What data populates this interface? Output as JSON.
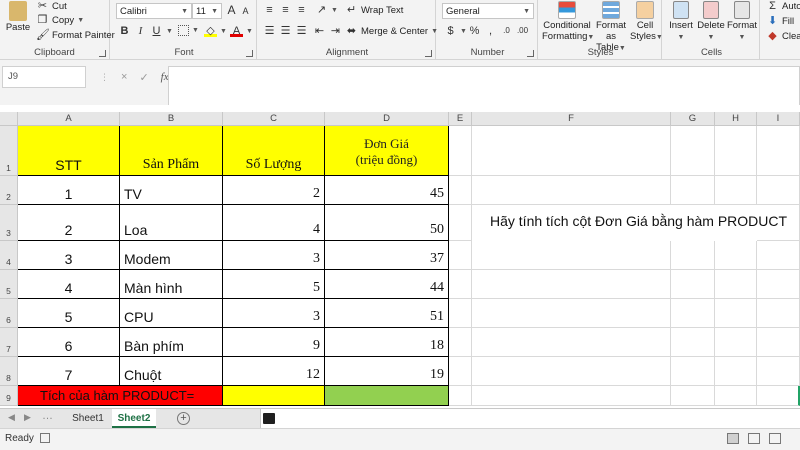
{
  "ribbon": {
    "clipboard": {
      "paste": "Paste",
      "cut": "Cut",
      "copy": "Copy",
      "format_painter": "Format Painter",
      "label": "Clipboard"
    },
    "font": {
      "name": "Calibri",
      "size": "11",
      "label": "Font"
    },
    "alignment": {
      "wrap_text": "Wrap Text",
      "merge_center": "Merge & Center",
      "label": "Alignment"
    },
    "number": {
      "format": "General",
      "label": "Number"
    },
    "styles": {
      "conditional_1": "Conditional",
      "conditional_2": "Formatting",
      "format_as_1": "Format as",
      "format_as_2": "Table",
      "cell_1": "Cell",
      "cell_2": "Styles",
      "label": "Styles"
    },
    "cells": {
      "insert": "Insert",
      "delete": "Delete",
      "format": "Format",
      "label": "Cells"
    },
    "editing": {
      "autosum": "Auto",
      "fill": "Fill",
      "clear": "Clear"
    }
  },
  "formula_bar": {
    "name_box": "J9",
    "fx": "fx",
    "cancel": "×",
    "enter": "✓",
    "content": ""
  },
  "columns": [
    "A",
    "B",
    "C",
    "D",
    "E",
    "F",
    "G",
    "H",
    "I"
  ],
  "rows": [
    "1",
    "2",
    "3",
    "4",
    "5",
    "6",
    "7",
    "8",
    "9"
  ],
  "table": {
    "headers": {
      "stt": "STT",
      "product": "Sản Phẩm",
      "qty": "Số Lượng",
      "price_1": "Đơn Giá",
      "price_2": "(triệu đồng)"
    },
    "rows": [
      {
        "stt": "1",
        "product": "TV",
        "qty": "2",
        "price": "45"
      },
      {
        "stt": "2",
        "product": "Loa",
        "qty": "4",
        "price": "50"
      },
      {
        "stt": "3",
        "product": "Modem",
        "qty": "3",
        "price": "37"
      },
      {
        "stt": "4",
        "product": "Màn hình",
        "qty": "5",
        "price": "44"
      },
      {
        "stt": "5",
        "product": "CPU",
        "qty": "3",
        "price": "51"
      },
      {
        "stt": "6",
        "product": "Bàn phím",
        "qty": "9",
        "price": "18"
      },
      {
        "stt": "7",
        "product": "Chuột",
        "qty": "12",
        "price": "19"
      }
    ],
    "total_label": "Tích của hàm PRODUCT=",
    "total_value": ""
  },
  "note": "Hãy tính tích cột Đơn Giá bằng hàm PRODUCT",
  "sheets": [
    {
      "name": "Sheet1",
      "active": false
    },
    {
      "name": "Sheet2",
      "active": true
    }
  ],
  "status": {
    "ready": "Ready"
  },
  "colors": {
    "yellow": "#ffff00",
    "red": "#ff0000",
    "green": "#92d050",
    "excel_green": "#1e7145"
  }
}
